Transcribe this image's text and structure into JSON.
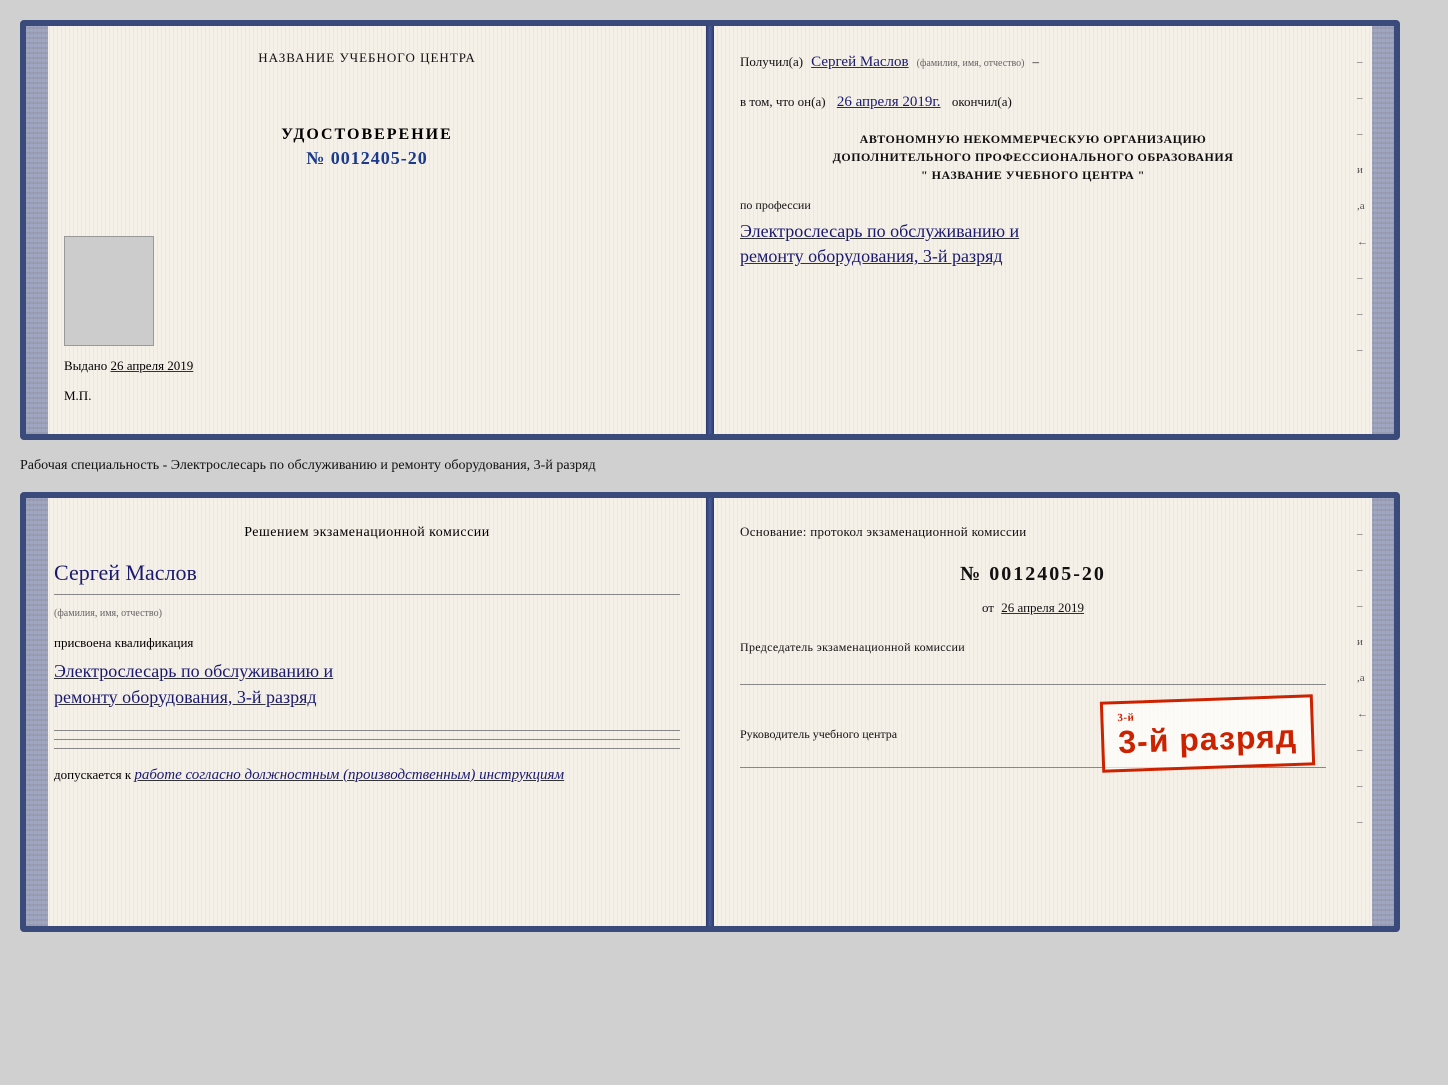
{
  "page": {
    "background": "#d0d0d0"
  },
  "top_book": {
    "left_page": {
      "center_title": "НАЗВАНИЕ УЧЕБНОГО ЦЕНТРА",
      "udostoverenie_label": "УДОСТОВЕРЕНИЕ",
      "number": "№ 0012405-20",
      "vydano_label": "Выдано",
      "vydano_date": "26 апреля 2019",
      "mp_label": "М.П."
    },
    "right_page": {
      "poluchil_prefix": "Получил(a)",
      "poluchil_name": "Сергей Маслов",
      "fio_label": "(фамилия, имя, отчество)",
      "dash": "–",
      "vtom_prefix": "в том, что он(а)",
      "vtom_date": "26 апреля 2019г.",
      "okonchl": "окончил(а)",
      "org_line1": "АВТОНОМНУЮ НЕКОММЕРЧЕСКУЮ ОРГАНИЗАЦИЮ",
      "org_line2": "ДОПОЛНИТЕЛЬНОГО ПРОФЕССИОНАЛЬНОГО ОБРАЗОВАНИЯ",
      "org_line3": "\"    НАЗВАНИЕ УЧЕБНОГО ЦЕНТРА    \"",
      "po_professii": "по профессии",
      "profession_line1": "Электрослесарь по обслуживанию и",
      "profession_line2": "ремонту оборудования, 3-й разряд"
    }
  },
  "between": {
    "text": "Рабочая специальность - Электрослесарь по обслуживанию и ремонту оборудования, 3-й разряд"
  },
  "bottom_book": {
    "left_page": {
      "resheniem": "Решением экзаменационной комиссии",
      "name": "Сергей Маслов",
      "fio_label": "(фамилия, имя, отчество)",
      "prisvoena": "присвоена квалификация",
      "qualification_line1": "Электрослесарь по обслуживанию и",
      "qualification_line2": "ремонту оборудования, 3-й разряд",
      "dopuskaetsya": "допускается к",
      "dopusk_text": "работе согласно должностным (производственным) инструкциям"
    },
    "right_page": {
      "osnovanie": "Основание: протокол экзаменационной комиссии",
      "number": "№  0012405-20",
      "ot_label": "от",
      "ot_date": "26 апреля 2019",
      "predsedatel": "Председатель экзаменационной комиссии",
      "rukovoditel": "Руководитель учебного центра"
    },
    "stamp": {
      "line1": "3-й",
      "line2": "разряд"
    }
  },
  "side_marks": {
    "items": [
      "–",
      "–",
      "–",
      "и",
      ",а",
      "←",
      "–",
      "–",
      "–"
    ]
  }
}
